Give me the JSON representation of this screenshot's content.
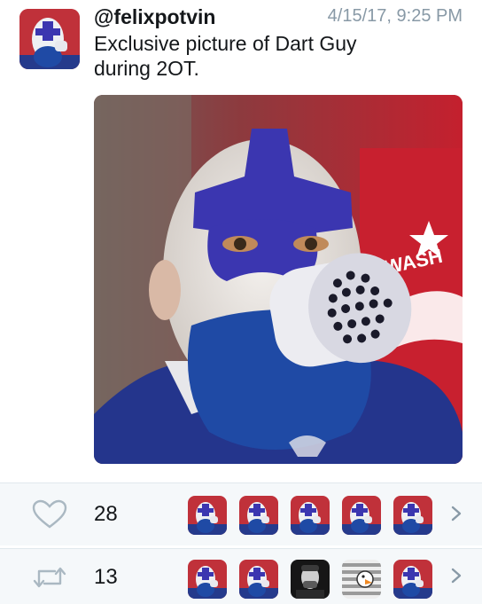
{
  "tweet": {
    "handle": "@felixpotvin",
    "timestamp": "4/15/17, 9:25 PM",
    "text_line1": "Exclusive picture of Dart Guy",
    "text_line2": "during 2OT.",
    "avatar_icon": "dart-guy-avatar",
    "media_icon": "dart-guy-photo"
  },
  "likes": {
    "count": "28",
    "icon": "heart-icon",
    "faces": [
      "dart-guy",
      "dart-guy",
      "dart-guy",
      "dart-guy",
      "dart-guy"
    ]
  },
  "retweets": {
    "count": "13",
    "icon": "retweet-icon",
    "faces": [
      "dart-guy",
      "dart-guy",
      "dark-portrait",
      "striped-cartoon",
      "dart-guy"
    ]
  },
  "colors": {
    "text": "#14171a",
    "muted": "#8899a6",
    "row_bg": "#f5f8fa",
    "border": "#e1e8ed",
    "paint_blue": "#3b36b0",
    "beard_blue": "#1f4aa5",
    "caps_red": "#c8202f"
  }
}
